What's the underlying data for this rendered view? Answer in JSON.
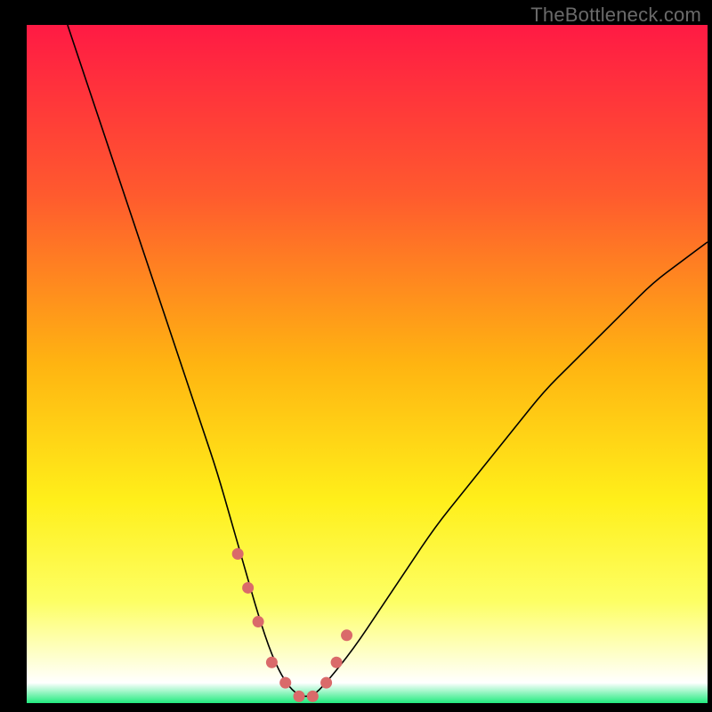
{
  "watermark": "TheBottleneck.com",
  "chart_data": {
    "type": "line",
    "title": "",
    "xlabel": "",
    "ylabel": "",
    "xlim": [
      0,
      100
    ],
    "ylim": [
      0,
      100
    ],
    "grid": false,
    "legend": false,
    "background_gradient": {
      "stops": [
        {
          "offset": 0.0,
          "color": "#ff1a44"
        },
        {
          "offset": 0.25,
          "color": "#ff5a2e"
        },
        {
          "offset": 0.5,
          "color": "#ffb411"
        },
        {
          "offset": 0.7,
          "color": "#ffef1a"
        },
        {
          "offset": 0.85,
          "color": "#fdff64"
        },
        {
          "offset": 0.97,
          "color": "#ffffff"
        },
        {
          "offset": 1.0,
          "color": "#21eb7f"
        }
      ]
    },
    "plot_frame": {
      "stroke": "#000000",
      "fill_outside": "#000000"
    },
    "series": [
      {
        "name": "bottleneck-curve",
        "type": "line",
        "color": "#000000",
        "width": 1.6,
        "x": [
          6,
          8,
          10,
          12,
          14,
          16,
          18,
          20,
          22,
          24,
          26,
          28,
          30,
          32,
          34,
          36,
          38,
          40,
          42,
          44,
          48,
          52,
          56,
          60,
          64,
          68,
          72,
          76,
          80,
          84,
          88,
          92,
          96,
          100
        ],
        "y": [
          100,
          94,
          88,
          82,
          76,
          70,
          64,
          58,
          52,
          46,
          40,
          34,
          27,
          20,
          13,
          7,
          3,
          1,
          1,
          3,
          8,
          14,
          20,
          26,
          31,
          36,
          41,
          46,
          50,
          54,
          58,
          62,
          65,
          68
        ]
      },
      {
        "name": "highlight-dots",
        "type": "scatter",
        "color": "#da6a6a",
        "size": 13,
        "x": [
          31,
          32.5,
          34,
          36,
          38,
          40,
          42,
          44,
          45.5,
          47
        ],
        "y": [
          22,
          17,
          12,
          6,
          3,
          1,
          1,
          3,
          6,
          10
        ]
      }
    ],
    "annotations": []
  }
}
